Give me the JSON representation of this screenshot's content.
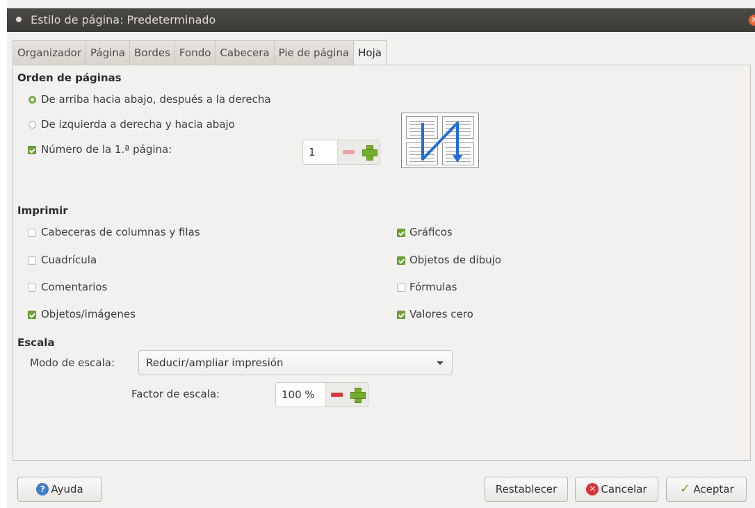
{
  "window": {
    "title": "Estilo de página: Predeterminado"
  },
  "tabs": [
    {
      "label": "Organizador"
    },
    {
      "label": "Página"
    },
    {
      "label": "Bordes"
    },
    {
      "label": "Fondo"
    },
    {
      "label": "Cabecera"
    },
    {
      "label": "Pie de página"
    },
    {
      "label": "Hoja",
      "active": true
    }
  ],
  "page_order": {
    "heading": "Orden de páginas",
    "option_top_down": {
      "label": "De arriba hacia abajo, después a la derecha",
      "selected": true
    },
    "option_left_right": {
      "label": "De izquierda a derecha y hacia abajo",
      "selected": false
    },
    "first_page": {
      "label": "Número de la 1.ª página:",
      "checked": true,
      "value": "1"
    }
  },
  "print": {
    "heading": "Imprimir",
    "headers": {
      "label": "Cabeceras de columnas y filas",
      "checked": false
    },
    "grid": {
      "label": "Cuadrícula",
      "checked": false
    },
    "comments": {
      "label": "Comentarios",
      "checked": false
    },
    "objects": {
      "label": "Objetos/imágenes",
      "checked": true
    },
    "charts": {
      "label": "Gráficos",
      "checked": true
    },
    "drawing": {
      "label": "Objetos de dibujo",
      "checked": true
    },
    "formulas": {
      "label": "Fórmulas",
      "checked": false
    },
    "zero_values": {
      "label": "Valores cero",
      "checked": true
    }
  },
  "scale": {
    "heading": "Escala",
    "mode_label": "Modo de escala:",
    "mode_value": "Reducir/ampliar impresión",
    "factor_label": "Factor de escala:",
    "factor_value": "100 %"
  },
  "buttons": {
    "help": "Ayuda",
    "reset": "Restablecer",
    "cancel": "Cancelar",
    "ok": "Aceptar"
  },
  "colors": {
    "arrow": "#1e6fd9",
    "check": "#6fa338",
    "minus": "#d9363e"
  }
}
